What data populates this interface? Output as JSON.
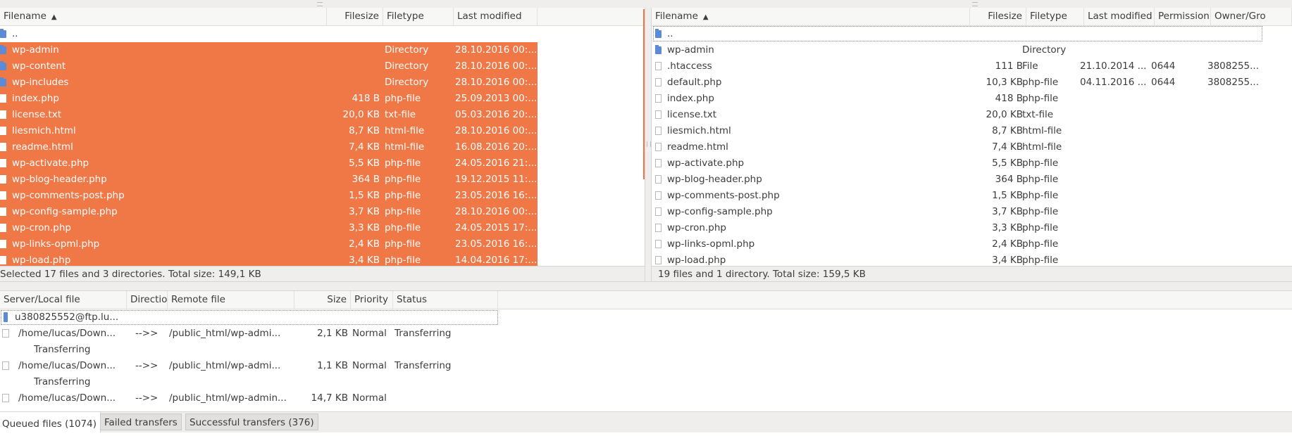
{
  "local": {
    "headers": {
      "filename": "Filename",
      "filesize": "Filesize",
      "filetype": "Filetype",
      "last_modified": "Last modified"
    },
    "rows": [
      {
        "name": "..",
        "size": "",
        "type": "",
        "modified": "",
        "icon": "folder-icon",
        "selected": false
      },
      {
        "name": "wp-admin",
        "size": "",
        "type": "Directory",
        "modified": "28.10.2016 00:...",
        "icon": "folder-icon",
        "selected": true
      },
      {
        "name": "wp-content",
        "size": "",
        "type": "Directory",
        "modified": "28.10.2016 00:...",
        "icon": "folder-icon",
        "selected": true
      },
      {
        "name": "wp-includes",
        "size": "",
        "type": "Directory",
        "modified": "28.10.2016 00:...",
        "icon": "folder-icon",
        "selected": true
      },
      {
        "name": "index.php",
        "size": "418 B",
        "type": "php-file",
        "modified": "25.09.2013 00:...",
        "icon": "file-icon",
        "selected": true
      },
      {
        "name": "license.txt",
        "size": "20,0 KB",
        "type": "txt-file",
        "modified": "05.03.2016 20:...",
        "icon": "file-icon",
        "selected": true
      },
      {
        "name": "liesmich.html",
        "size": "8,7 KB",
        "type": "html-file",
        "modified": "28.10.2016 00:...",
        "icon": "file-icon",
        "selected": true
      },
      {
        "name": "readme.html",
        "size": "7,4 KB",
        "type": "html-file",
        "modified": "16.08.2016 20:...",
        "icon": "file-icon",
        "selected": true
      },
      {
        "name": "wp-activate.php",
        "size": "5,5 KB",
        "type": "php-file",
        "modified": "24.05.2016 21:...",
        "icon": "file-icon",
        "selected": true
      },
      {
        "name": "wp-blog-header.php",
        "size": "364 B",
        "type": "php-file",
        "modified": "19.12.2015 11:...",
        "icon": "file-icon",
        "selected": true
      },
      {
        "name": "wp-comments-post.php",
        "size": "1,5 KB",
        "type": "php-file",
        "modified": "23.05.2016 16:...",
        "icon": "file-icon",
        "selected": true
      },
      {
        "name": "wp-config-sample.php",
        "size": "3,7 KB",
        "type": "php-file",
        "modified": "28.10.2016 00:...",
        "icon": "file-icon",
        "selected": true
      },
      {
        "name": "wp-cron.php",
        "size": "3,3 KB",
        "type": "php-file",
        "modified": "24.05.2015 17:...",
        "icon": "file-icon",
        "selected": true
      },
      {
        "name": "wp-links-opml.php",
        "size": "2,4 KB",
        "type": "php-file",
        "modified": "23.05.2016 16:...",
        "icon": "file-icon",
        "selected": true
      },
      {
        "name": "wp-load.php",
        "size": "3,4 KB",
        "type": "php-file",
        "modified": "14.04.2016 17:...",
        "icon": "file-icon",
        "selected": true
      }
    ],
    "status": "Selected 17 files and 3 directories. Total size: 149,1 KB"
  },
  "remote": {
    "headers": {
      "filename": "Filename",
      "filesize": "Filesize",
      "filetype": "Filetype",
      "last_modified": "Last modified",
      "permissions": "Permission",
      "owner": "Owner/Gro"
    },
    "rows": [
      {
        "name": "..",
        "size": "",
        "type": "",
        "modified": "",
        "perm": "",
        "owner": "",
        "icon": "folder-icon"
      },
      {
        "name": "wp-admin",
        "size": "",
        "type": "Directory",
        "modified": "",
        "perm": "",
        "owner": "",
        "icon": "folder-icon"
      },
      {
        "name": ".htaccess",
        "size": "111 B",
        "type": "File",
        "modified": "21.10.2014 ...",
        "perm": "0644",
        "owner": "3808255...",
        "icon": "file-icon"
      },
      {
        "name": "default.php",
        "size": "10,3 KB",
        "type": "php-file",
        "modified": "04.11.2016 ...",
        "perm": "0644",
        "owner": "3808255...",
        "icon": "file-icon"
      },
      {
        "name": "index.php",
        "size": "418 B",
        "type": "php-file",
        "modified": "",
        "perm": "",
        "owner": "",
        "icon": "file-icon"
      },
      {
        "name": "license.txt",
        "size": "20,0 KB",
        "type": "txt-file",
        "modified": "",
        "perm": "",
        "owner": "",
        "icon": "file-icon"
      },
      {
        "name": "liesmich.html",
        "size": "8,7 KB",
        "type": "html-file",
        "modified": "",
        "perm": "",
        "owner": "",
        "icon": "file-icon"
      },
      {
        "name": "readme.html",
        "size": "7,4 KB",
        "type": "html-file",
        "modified": "",
        "perm": "",
        "owner": "",
        "icon": "file-icon"
      },
      {
        "name": "wp-activate.php",
        "size": "5,5 KB",
        "type": "php-file",
        "modified": "",
        "perm": "",
        "owner": "",
        "icon": "file-icon"
      },
      {
        "name": "wp-blog-header.php",
        "size": "364 B",
        "type": "php-file",
        "modified": "",
        "perm": "",
        "owner": "",
        "icon": "file-icon"
      },
      {
        "name": "wp-comments-post.php",
        "size": "1,5 KB",
        "type": "php-file",
        "modified": "",
        "perm": "",
        "owner": "",
        "icon": "file-icon"
      },
      {
        "name": "wp-config-sample.php",
        "size": "3,7 KB",
        "type": "php-file",
        "modified": "",
        "perm": "",
        "owner": "",
        "icon": "file-icon"
      },
      {
        "name": "wp-cron.php",
        "size": "3,3 KB",
        "type": "php-file",
        "modified": "",
        "perm": "",
        "owner": "",
        "icon": "file-icon"
      },
      {
        "name": "wp-links-opml.php",
        "size": "2,4 KB",
        "type": "php-file",
        "modified": "",
        "perm": "",
        "owner": "",
        "icon": "file-icon"
      },
      {
        "name": "wp-load.php",
        "size": "3,4 KB",
        "type": "php-file",
        "modified": "",
        "perm": "",
        "owner": "",
        "icon": "file-icon"
      }
    ],
    "status": "19 files and 1 directory. Total size: 159,5 KB"
  },
  "queue": {
    "headers": {
      "server_local": "Server/Local file",
      "direction": "Directio",
      "remote": "Remote file",
      "size": "Size",
      "priority": "Priority",
      "status": "Status"
    },
    "server": "u380825552@ftp.lu...",
    "items": [
      {
        "local": "/home/lucas/Down...",
        "direction": "-->>",
        "remote": "/public_html/wp-admi...",
        "size": "2,1 KB",
        "priority": "Normal",
        "status": "Transferring",
        "detail": "Transferring"
      },
      {
        "local": "/home/lucas/Down...",
        "direction": "-->>",
        "remote": "/public_html/wp-admi...",
        "size": "1,1 KB",
        "priority": "Normal",
        "status": "Transferring",
        "detail": "Transferring"
      },
      {
        "local": "/home/lucas/Down...",
        "direction": "-->>",
        "remote": "/public_html/wp-admin...",
        "size": "14,7 KB",
        "priority": "Normal",
        "status": "",
        "detail": ""
      }
    ]
  },
  "tabs": [
    {
      "label": "Queued files (1074)",
      "active": true
    },
    {
      "label": "Failed transfers",
      "active": false
    },
    {
      "label": "Successful transfers (376)",
      "active": false
    }
  ],
  "colors": {
    "selection": "#f07746",
    "folder": "#5b8ad6",
    "chrome": "#efeeec"
  }
}
